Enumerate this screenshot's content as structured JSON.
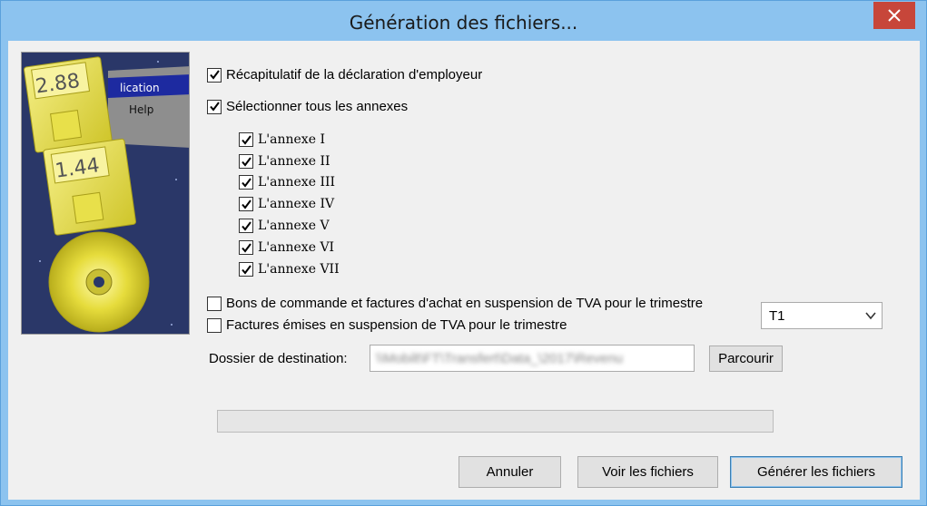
{
  "window": {
    "title": "Génération des fichiers..."
  },
  "image": {
    "disk1_label": "2.88",
    "disk2_label": "1.44",
    "menu_text": "lication",
    "menu_help": "Help"
  },
  "options": {
    "recap": {
      "label": "Récapitulatif de la déclaration d'employeur",
      "checked": true
    },
    "select_all": {
      "label": "Sélectionner tous les annexes",
      "checked": true
    },
    "annexes": [
      {
        "label": "L'annexe I",
        "checked": true
      },
      {
        "label": "L'annexe II",
        "checked": true
      },
      {
        "label": "L'annexe III",
        "checked": true
      },
      {
        "label": "L'annexe IV",
        "checked": true
      },
      {
        "label": "L'annexe V",
        "checked": true
      },
      {
        "label": "L'annexe VI",
        "checked": true
      },
      {
        "label": "L'annexe VII",
        "checked": true
      }
    ],
    "bons": {
      "label": "Bons de commande et factures d'achat en suspension de TVA pour le trimestre",
      "checked": false
    },
    "factures": {
      "label": "Factures émises en suspension de TVA pour le trimestre",
      "checked": false
    }
  },
  "quarter_select": {
    "value": "T1"
  },
  "destination": {
    "label": "Dossier de destination:",
    "value": "\\\\Mobilt\\FT\\Transfert\\Data_\\2017\\Revenu",
    "browse_label": "Parcourir"
  },
  "progress": {
    "value": 0
  },
  "buttons": {
    "cancel": "Annuler",
    "view": "Voir les fichiers",
    "generate": "Générer les fichiers"
  },
  "colors": {
    "titlebar": "#8cc3ef",
    "close": "#c7463a",
    "dialog_bg": "#f0f0f0",
    "disk_yellow": "#e8e04a"
  }
}
